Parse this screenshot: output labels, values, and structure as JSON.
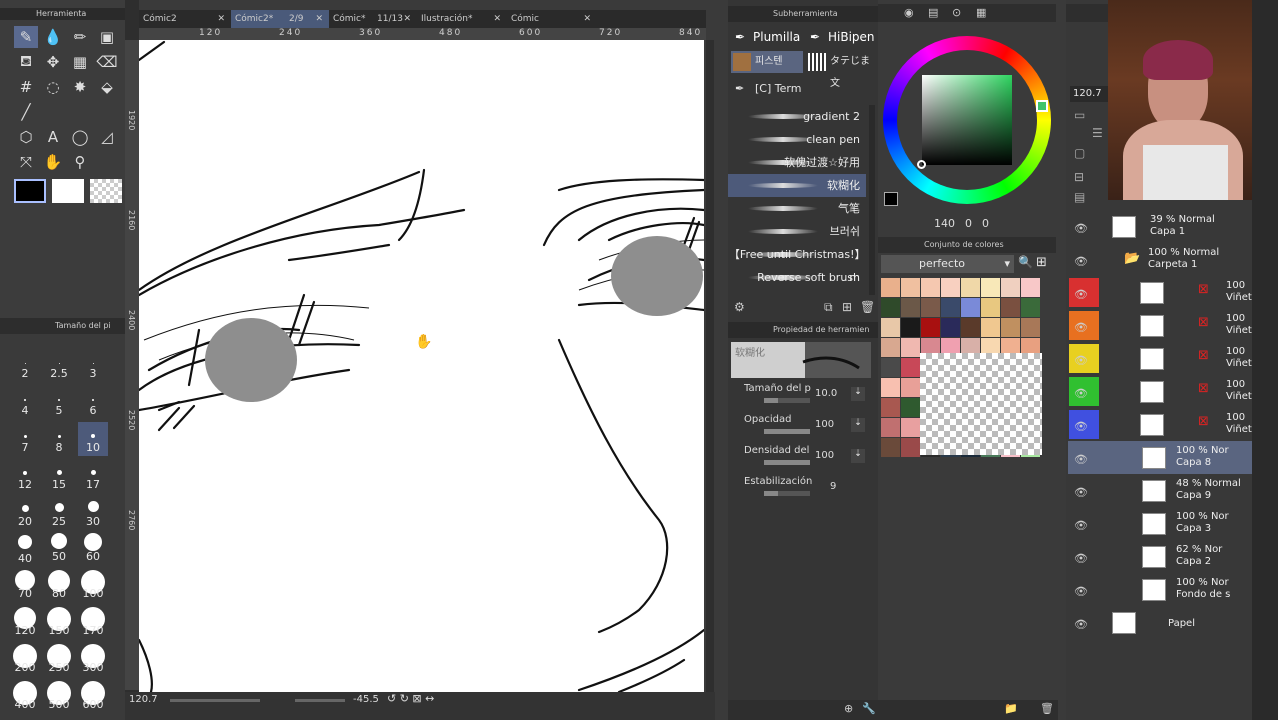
{
  "tool_panel": {
    "title": "Herramienta"
  },
  "brush_size_panel": {
    "title": "Tamaño del pi",
    "sizes": [
      "2",
      "2.5",
      "3",
      "4",
      "5",
      "6",
      "7",
      "8",
      "10",
      "12",
      "15",
      "17",
      "20",
      "25",
      "30",
      "40",
      "50",
      "60",
      "70",
      "80",
      "100",
      "120",
      "150",
      "170",
      "200",
      "250",
      "300",
      "400",
      "500",
      "600"
    ]
  },
  "tabs": [
    {
      "label": "Cómic2",
      "page": ""
    },
    {
      "label": "Cómic2*",
      "page": "2/9"
    },
    {
      "label": "Cómic*",
      "page": "11/13"
    },
    {
      "label": "Ilustración*",
      "page": ""
    },
    {
      "label": "Cómic",
      "page": ""
    }
  ],
  "ruler": {
    "top": [
      "120",
      "240",
      "360",
      "480",
      "600",
      "720",
      "840"
    ],
    "left": [
      "1920",
      "2160",
      "2400",
      "2520",
      "2760"
    ]
  },
  "canvas_status": {
    "zoom": "120.7",
    "angle": "-45.5"
  },
  "subtool": {
    "title": "Subherramienta",
    "groups": [
      "Plumilla",
      "HiBipen"
    ],
    "selected_label": "피스텐",
    "second_label": "タテじま文",
    "folder": "[C] Term",
    "brushes": [
      "gradient 2",
      "clean pen",
      "软傀过渡☆好用",
      "软糊化",
      "气笔",
      "브러쉬",
      "【Free until Christmas!】m",
      "Reverse soft brush"
    ]
  },
  "tool_property": {
    "title": "Propiedad de herramien",
    "brush_name": "软糊化",
    "rows": [
      {
        "label": "Tamaño del p",
        "value": "10.0",
        "fill": 0.3
      },
      {
        "label": "Opacidad",
        "value": "100",
        "fill": 1.0
      },
      {
        "label": "Densidad del",
        "value": "100",
        "fill": 1.0
      },
      {
        "label": "Estabilización",
        "value": "9",
        "fill": 0.3
      }
    ]
  },
  "color_wheel": {
    "readout": [
      "140",
      "0",
      "0"
    ],
    "accent": "#3ec46a"
  },
  "color_set": {
    "title": "Conjunto de colores",
    "set_name": "perfecto",
    "swatches": [
      "#e9b08c",
      "#f0c0a0",
      "#f5c8b0",
      "#f8d0c0",
      "#f0d8a8",
      "#f8e8b8",
      "#f0d0c0",
      "#f8c8c8",
      "#2f4a2a",
      "#6b5848",
      "#7a5a4a",
      "#3a4a6a",
      "#7a8ad8",
      "#e8c880",
      "#7a5040",
      "#3a6a3a",
      "#e8c8a8",
      "#1a1a1a",
      "#a81010",
      "#2a2a5a",
      "#5a3a2a",
      "#f0c890",
      "#c09060",
      "#a87858",
      "#d8a890",
      "#f0b8b0",
      "#d88890",
      "#f0a0b0",
      "#d8b0a8",
      "#f8d8b0",
      "#f0b090",
      "#e8a080",
      "#4a4a4a",
      "#c84858",
      "#a02840",
      "#f0f0f0",
      "",
      "",
      "",
      "",
      "#f8c0b0",
      "#e8a098",
      "",
      "",
      "",
      "",
      "",
      "",
      "#a85850",
      "#2f5a2f",
      "",
      "",
      "",
      "",
      "",
      "",
      "#c07070",
      "#e8a0a0",
      "",
      "",
      "",
      "",
      "",
      "",
      "#6a4a3a",
      "#9a4a4a",
      "#2a2a2a",
      "#2a3a4a",
      "#1a2a3a",
      "#4a7a5a",
      "#f8c0c8",
      "#a8e8a0"
    ]
  },
  "layers": {
    "zoom_value": "120.7",
    "items": [
      {
        "mode": "39 % Normal",
        "name": "Capa 1"
      },
      {
        "mode": "100 % Normal",
        "name": "Carpeta 1"
      },
      {
        "mode": "100",
        "name": "Viñet"
      },
      {
        "mode": "100",
        "name": "Viñet"
      },
      {
        "mode": "100",
        "name": "Viñet"
      },
      {
        "mode": "100",
        "name": "Viñet"
      },
      {
        "mode": "100",
        "name": "Viñet"
      },
      {
        "mode": "100 % Nor",
        "name": "Capa 8"
      },
      {
        "mode": "48 % Normal",
        "name": "Capa 9"
      },
      {
        "mode": "100 % Nor",
        "name": "Capa 3"
      },
      {
        "mode": "62 % Nor",
        "name": "Capa 2"
      },
      {
        "mode": "100 % Nor",
        "name": "Fondo de s"
      },
      {
        "mode": "",
        "name": "Papel"
      }
    ],
    "color_tags": [
      "#d83030",
      "#e87020",
      "#e8d020",
      "#30c030",
      "#4050e0"
    ]
  }
}
